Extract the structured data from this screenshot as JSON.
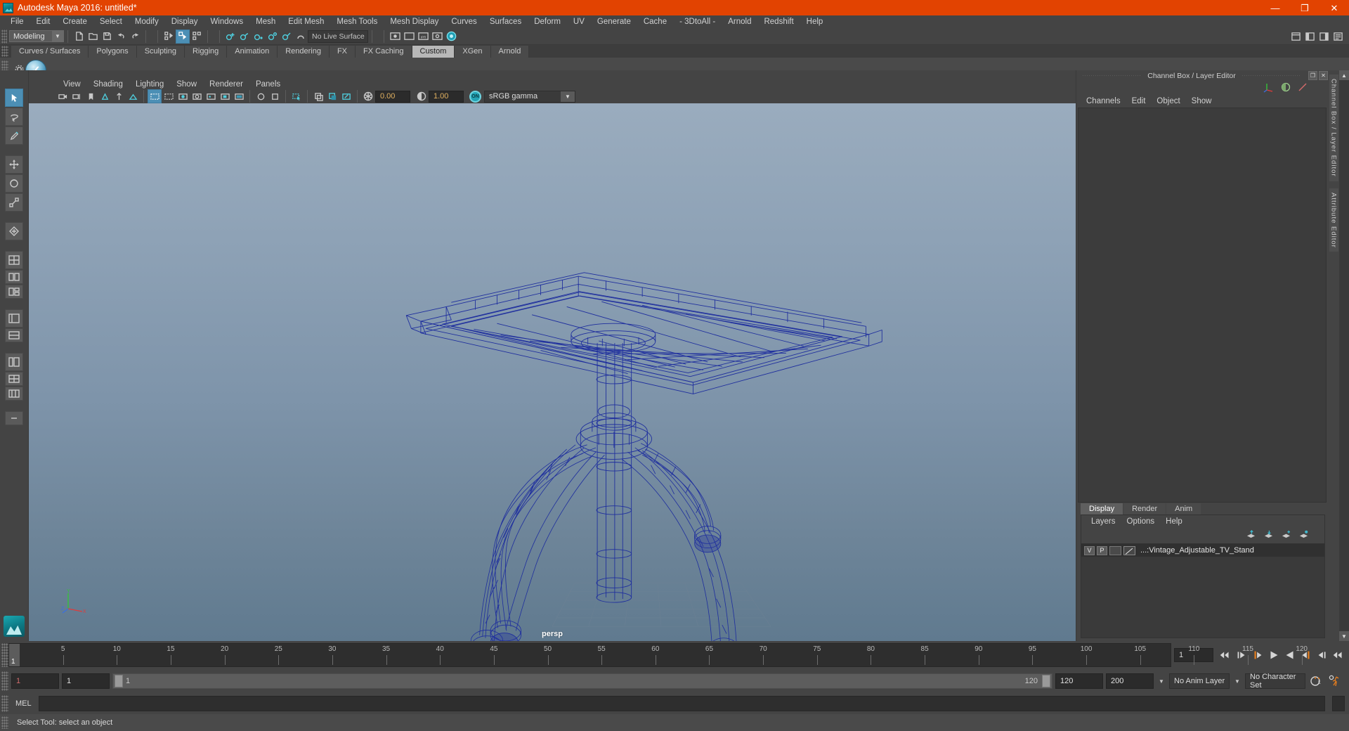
{
  "window": {
    "title": "Autodesk Maya 2016: untitled*",
    "minimize": "—",
    "maximize": "❐",
    "close": "✕",
    "accent_color": "#e24301"
  },
  "menu_bar": {
    "items": [
      "File",
      "Edit",
      "Create",
      "Select",
      "Modify",
      "Display",
      "Windows",
      "Mesh",
      "Edit Mesh",
      "Mesh Tools",
      "Mesh Display",
      "Curves",
      "Surfaces",
      "Deform",
      "UV",
      "Generate",
      "Cache",
      "- 3DtoAll -",
      "Arnold",
      "Redshift",
      "Help"
    ]
  },
  "status_line": {
    "menu_set": "Modeling",
    "live_surface": "No Live Surface"
  },
  "shelf": {
    "tabs": [
      "Curves / Surfaces",
      "Polygons",
      "Sculpting",
      "Rigging",
      "Animation",
      "Rendering",
      "FX",
      "FX Caching",
      "Custom",
      "XGen",
      "Arnold"
    ],
    "active_tab": "Custom",
    "gear_icon": "gear-icon",
    "item_icon": "maya-sphere-icon"
  },
  "viewport": {
    "menus": [
      "View",
      "Shading",
      "Lighting",
      "Show",
      "Renderer",
      "Panels"
    ],
    "exposure_value": "0.00",
    "gamma_value": "1.00",
    "color_management": "sRGB gamma",
    "color_toggle": "ON",
    "camera_label": "persp",
    "model": {
      "name": "Vintage_Adjustable_TV_Stand",
      "wireframe_color": "#1f2f9e",
      "shading": "wireframe"
    }
  },
  "channel_box": {
    "title": "Channel Box / Layer Editor",
    "menus": [
      "Channels",
      "Edit",
      "Object",
      "Show"
    ],
    "float_button": "❐",
    "close_button": "✕"
  },
  "layer_editor": {
    "tabs": [
      "Display",
      "Render",
      "Anim"
    ],
    "active_tab": "Display",
    "menus": [
      "Layers",
      "Options",
      "Help"
    ],
    "layers": [
      {
        "visibility": "V",
        "playback": "P",
        "name": "...:Vintage_Adjustable_TV_Stand"
      }
    ]
  },
  "side_tabs": [
    "Channel Box / Layer Editor",
    "Attribute Editor"
  ],
  "timeline": {
    "current_frame": "1",
    "ticks": [
      5,
      10,
      15,
      20,
      25,
      30,
      35,
      40,
      45,
      50,
      55,
      60,
      65,
      70,
      75,
      80,
      85,
      90,
      95,
      100,
      105,
      110,
      115,
      120
    ],
    "frame_field": "1",
    "playback_buttons": [
      "go-to-start-icon",
      "step-back-key-icon",
      "step-back-frame-icon",
      "play-backwards-icon",
      "play-forwards-icon",
      "step-forward-frame-icon",
      "step-forward-key-icon",
      "go-to-end-icon"
    ]
  },
  "range_slider": {
    "anim_start": "1",
    "playback_start": "1",
    "slider_start_label": "1",
    "slider_end_label": "120",
    "playback_end": "120",
    "anim_end": "200",
    "anim_layer": "No Anim Layer",
    "character_set": "No Character Set",
    "auto_key_icon": "auto-keyframe-icon",
    "anim_prefs_icon": "animation-preferences-icon"
  },
  "command_line": {
    "label": "MEL",
    "value": ""
  },
  "status_bar": {
    "help_text": "Select Tool: select an object"
  }
}
